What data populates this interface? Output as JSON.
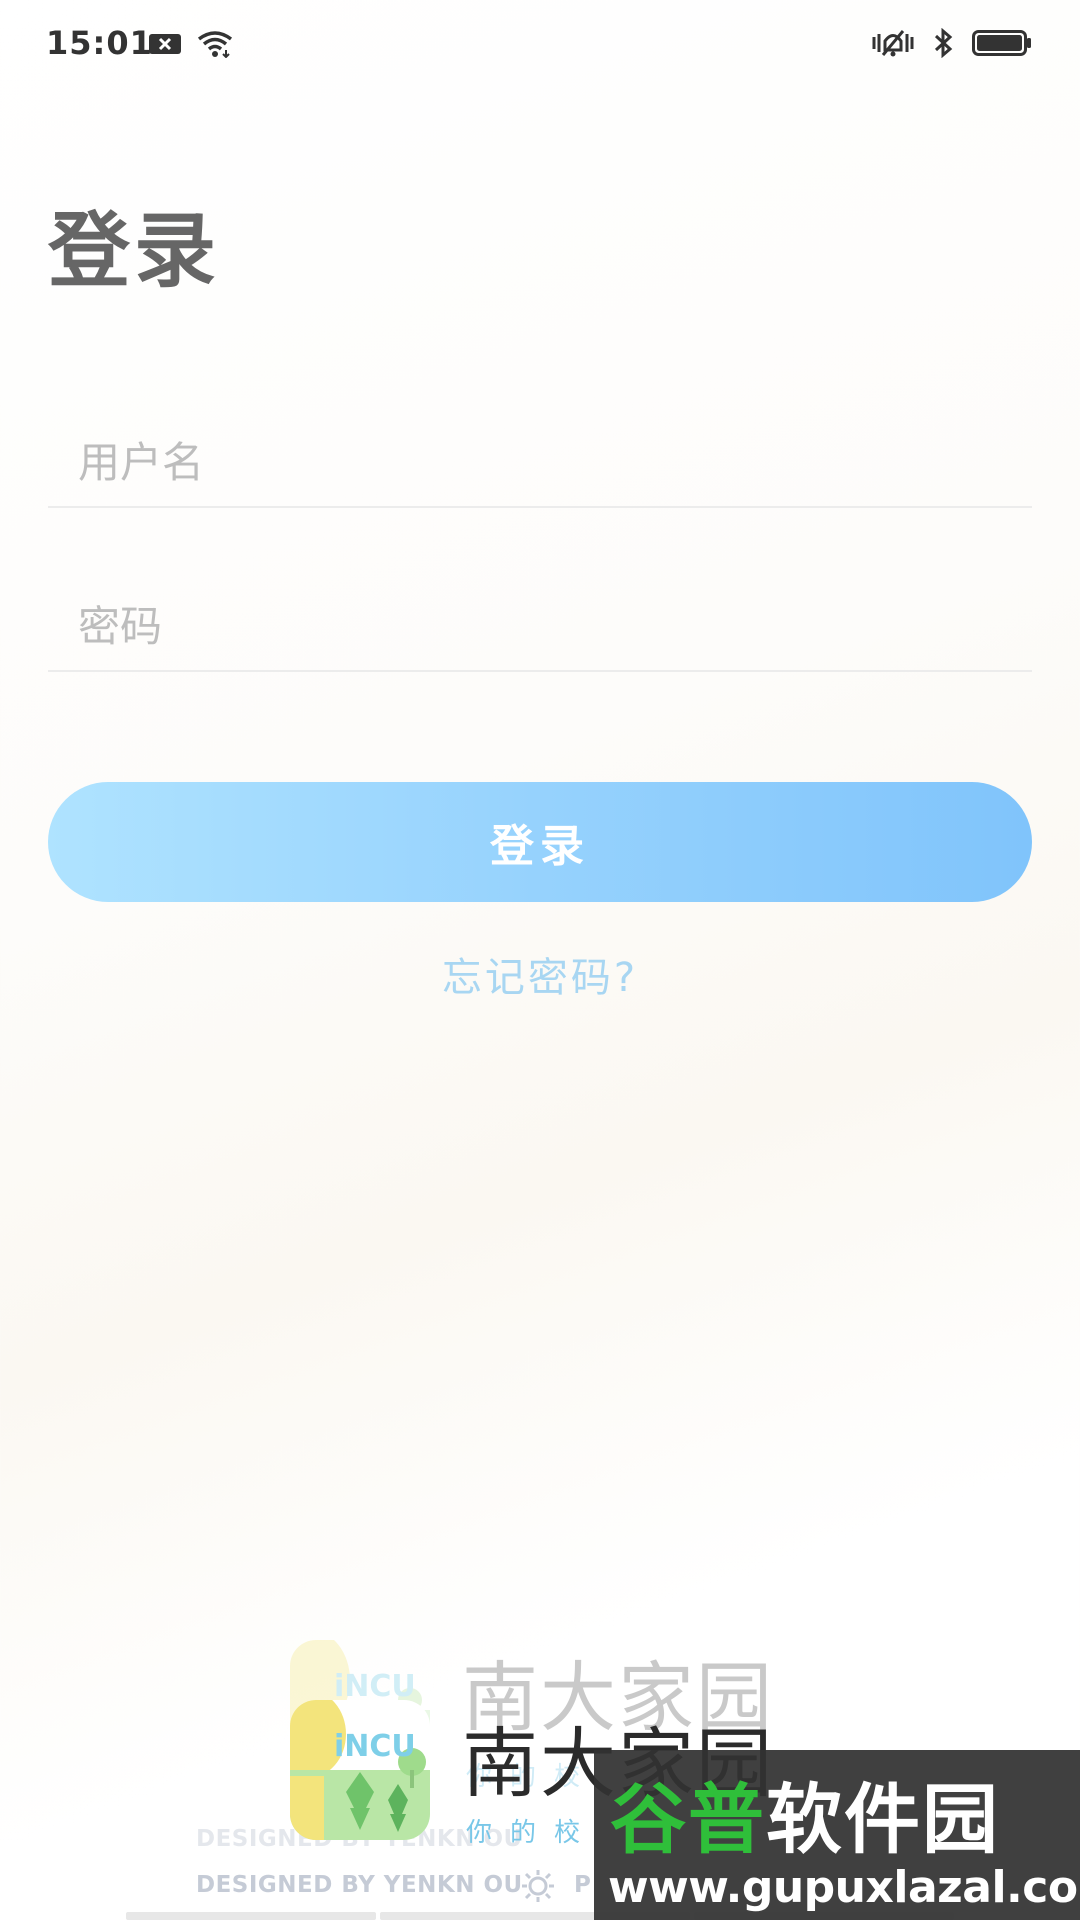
{
  "status_bar": {
    "time": "15:01",
    "left_icons": [
      "close-box-icon",
      "wifi-icon"
    ],
    "right_icons": [
      "vibrate-icon",
      "bluetooth-icon",
      "battery-icon"
    ]
  },
  "page": {
    "title": "登录"
  },
  "form": {
    "username_placeholder": "用户名",
    "username_value": "",
    "password_placeholder": "密码",
    "password_value": "",
    "login_label": "登录",
    "forgot_label": "忘记密码?"
  },
  "footer": {
    "logo_text": "iNCU",
    "brand_name": "南大家园",
    "slogan": "你的校",
    "designer": "DESIGNED BY YENKN OU",
    "credit_tail": "P"
  },
  "watermark": {
    "title_part1": "谷普",
    "title_part2": "软件园",
    "url": "www.gupuxlazal.com"
  },
  "colors": {
    "accent_start": "#afe3ff",
    "accent_end": "#80c4fb",
    "link": "#a8d6f2",
    "title": "#666666"
  }
}
